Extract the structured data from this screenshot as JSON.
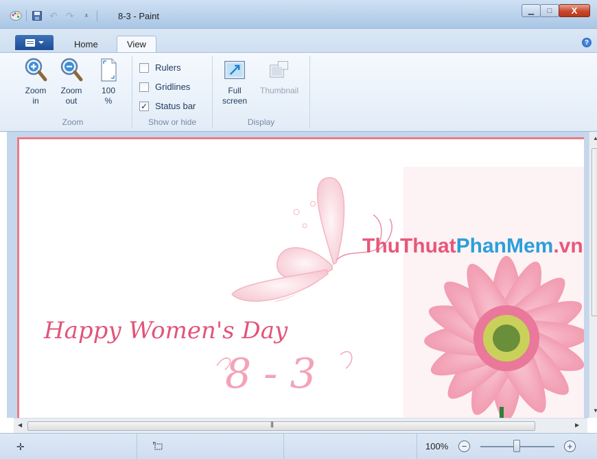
{
  "window": {
    "title": "8-3 - Paint",
    "controls": {
      "minimize": "▁",
      "maximize": "□",
      "close": "X"
    }
  },
  "tabs": {
    "home": "Home",
    "view": "View",
    "help": "?"
  },
  "ribbon": {
    "zoom": {
      "label": "Zoom",
      "zoom_in": [
        "Zoom",
        "in"
      ],
      "zoom_out": [
        "Zoom",
        "out"
      ],
      "hundred": [
        "100",
        "%"
      ]
    },
    "show_or_hide": {
      "label": "Show or hide",
      "items": [
        {
          "label": "Rulers",
          "checked": false
        },
        {
          "label": "Gridlines",
          "checked": false
        },
        {
          "label": "Status bar",
          "checked": true
        }
      ]
    },
    "display": {
      "label": "Display",
      "full_screen": [
        "Full",
        "screen"
      ],
      "thumbnail": "Thumbnail"
    }
  },
  "canvas": {
    "watermark_thu": "ThuThuat",
    "watermark_phan": "PhanMem",
    "watermark_tld": ".vn",
    "greeting": "Happy Women's Day",
    "date": "8-3",
    "colors": {
      "border": "#ec7a86",
      "watermark_pink": "#e8567a",
      "watermark_blue": "#2b9fd8"
    }
  },
  "status": {
    "zoom": "100%",
    "zoom_level": 0.5
  }
}
